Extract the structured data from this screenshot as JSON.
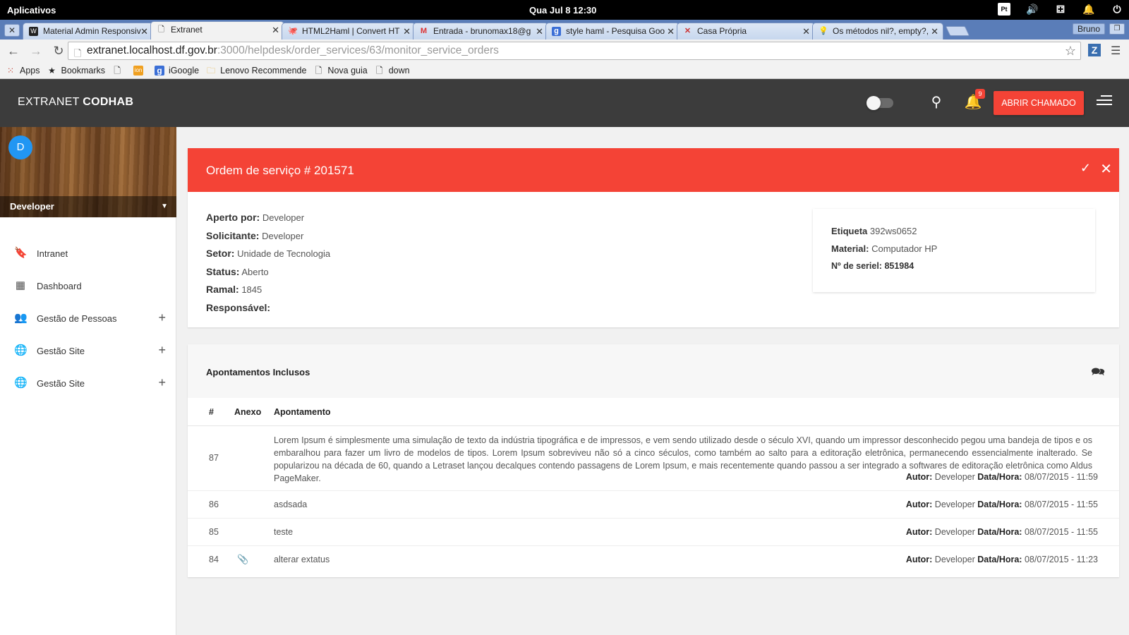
{
  "system": {
    "app_label": "Aplicativos",
    "clock": "Qua Jul  8    12:30"
  },
  "browser": {
    "profile": "Bruno",
    "tabs": [
      {
        "label": "Material Admin Responsiv",
        "icon": "W"
      },
      {
        "label": "Extranet",
        "icon": "🗋"
      },
      {
        "label": "HTML2Haml | Convert HT",
        "icon": "🐙"
      },
      {
        "label": "Entrada - brunomax18@g",
        "icon": "M"
      },
      {
        "label": "style haml - Pesquisa Goo",
        "icon": "g"
      },
      {
        "label": "Casa Própria",
        "icon": "✕"
      },
      {
        "label": "Os métodos nil?, empty?,",
        "icon": "💡"
      }
    ],
    "url_host": "extranet.localhost.df.gov.br",
    "url_rest": ":3000/helpdesk/order_services/63/monitor_service_orders",
    "bookmarks": [
      {
        "label": "Apps",
        "icon": "apps-grid"
      },
      {
        "label": "Bookmarks",
        "icon": "star"
      },
      {
        "label": "",
        "icon": "page"
      },
      {
        "label": "",
        "icon": "ion"
      },
      {
        "label": "iGoogle",
        "icon": "google"
      },
      {
        "label": "Lenovo Recommende",
        "icon": "folder"
      },
      {
        "label": "Nova guia",
        "icon": "page"
      },
      {
        "label": "down",
        "icon": "page"
      }
    ]
  },
  "header": {
    "brand_light": "EXTRANET",
    "brand_bold": "CODHAB",
    "notifications_count": "9",
    "open_ticket_label": "ABRIR CHAMADO"
  },
  "sidebar": {
    "avatar_initial": "D",
    "user_name": "Developer",
    "items": [
      {
        "label": "Intranet",
        "icon": "bookmark-icon",
        "expandable": false
      },
      {
        "label": "Dashboard",
        "icon": "dashboard-icon",
        "expandable": false
      },
      {
        "label": "Gestão de Pessoas",
        "icon": "people-icon",
        "expandable": true
      },
      {
        "label": "Gestão Site",
        "icon": "globe-icon",
        "expandable": true
      },
      {
        "label": "Gestão Site",
        "icon": "globe-icon",
        "expandable": true
      }
    ]
  },
  "order": {
    "title": "Ordem de serviço # 201571",
    "fields": {
      "opened_by_label": "Aperto por:",
      "opened_by": "Developer",
      "requester_label": "Solicitante:",
      "requester": "Developer",
      "sector_label": "Setor:",
      "sector": "Unidade de Tecnologia",
      "status_label": "Status:",
      "status": "Aberto",
      "extension_label": "Ramal:",
      "extension": "1845",
      "responsible_label": "Responsável:",
      "responsible": ""
    },
    "equipment": {
      "tag_label": "Etiqueta",
      "tag": "392ws0652",
      "material_label": "Material:",
      "material": "Computador HP",
      "serial_label": "Nº de seriel:",
      "serial": "851984"
    }
  },
  "notes": {
    "title": "Apontamentos Inclusos",
    "columns": [
      "#",
      "Anexo",
      "Apontamento"
    ],
    "author_label": "Autor:",
    "datetime_label": "Data/Hora:",
    "rows": [
      {
        "id": "87",
        "attachment": false,
        "text": "Lorem Ipsum é simplesmente uma simulação de texto da indústria tipográfica e de impressos, e vem sendo utilizado desde o século XVI, quando um impressor desconhecido pegou uma bandeja de tipos e os embaralhou para fazer um livro de modelos de tipos. Lorem Ipsum sobreviveu não só a cinco séculos, como também ao salto para a editoração eletrônica, permanecendo essencialmente inalterado. Se popularizou na década de 60, quando a Letraset lançou decalques contendo passagens de Lorem Ipsum, e mais recentemente quando passou a ser integrado a softwares de editoração eletrônica como Aldus PageMaker.",
        "author": "Developer",
        "datetime": "08/07/2015 - 11:59"
      },
      {
        "id": "86",
        "attachment": false,
        "text": "asdsada",
        "author": "Developer",
        "datetime": "08/07/2015 - 11:55"
      },
      {
        "id": "85",
        "attachment": false,
        "text": "teste",
        "author": "Developer",
        "datetime": "08/07/2015 - 11:55"
      },
      {
        "id": "84",
        "attachment": true,
        "text": "alterar extatus",
        "author": "Developer",
        "datetime": "08/07/2015 - 11:23"
      }
    ]
  },
  "colors": {
    "accent": "#f44336",
    "header": "#3c3c3c",
    "avatar": "#2196f3"
  }
}
